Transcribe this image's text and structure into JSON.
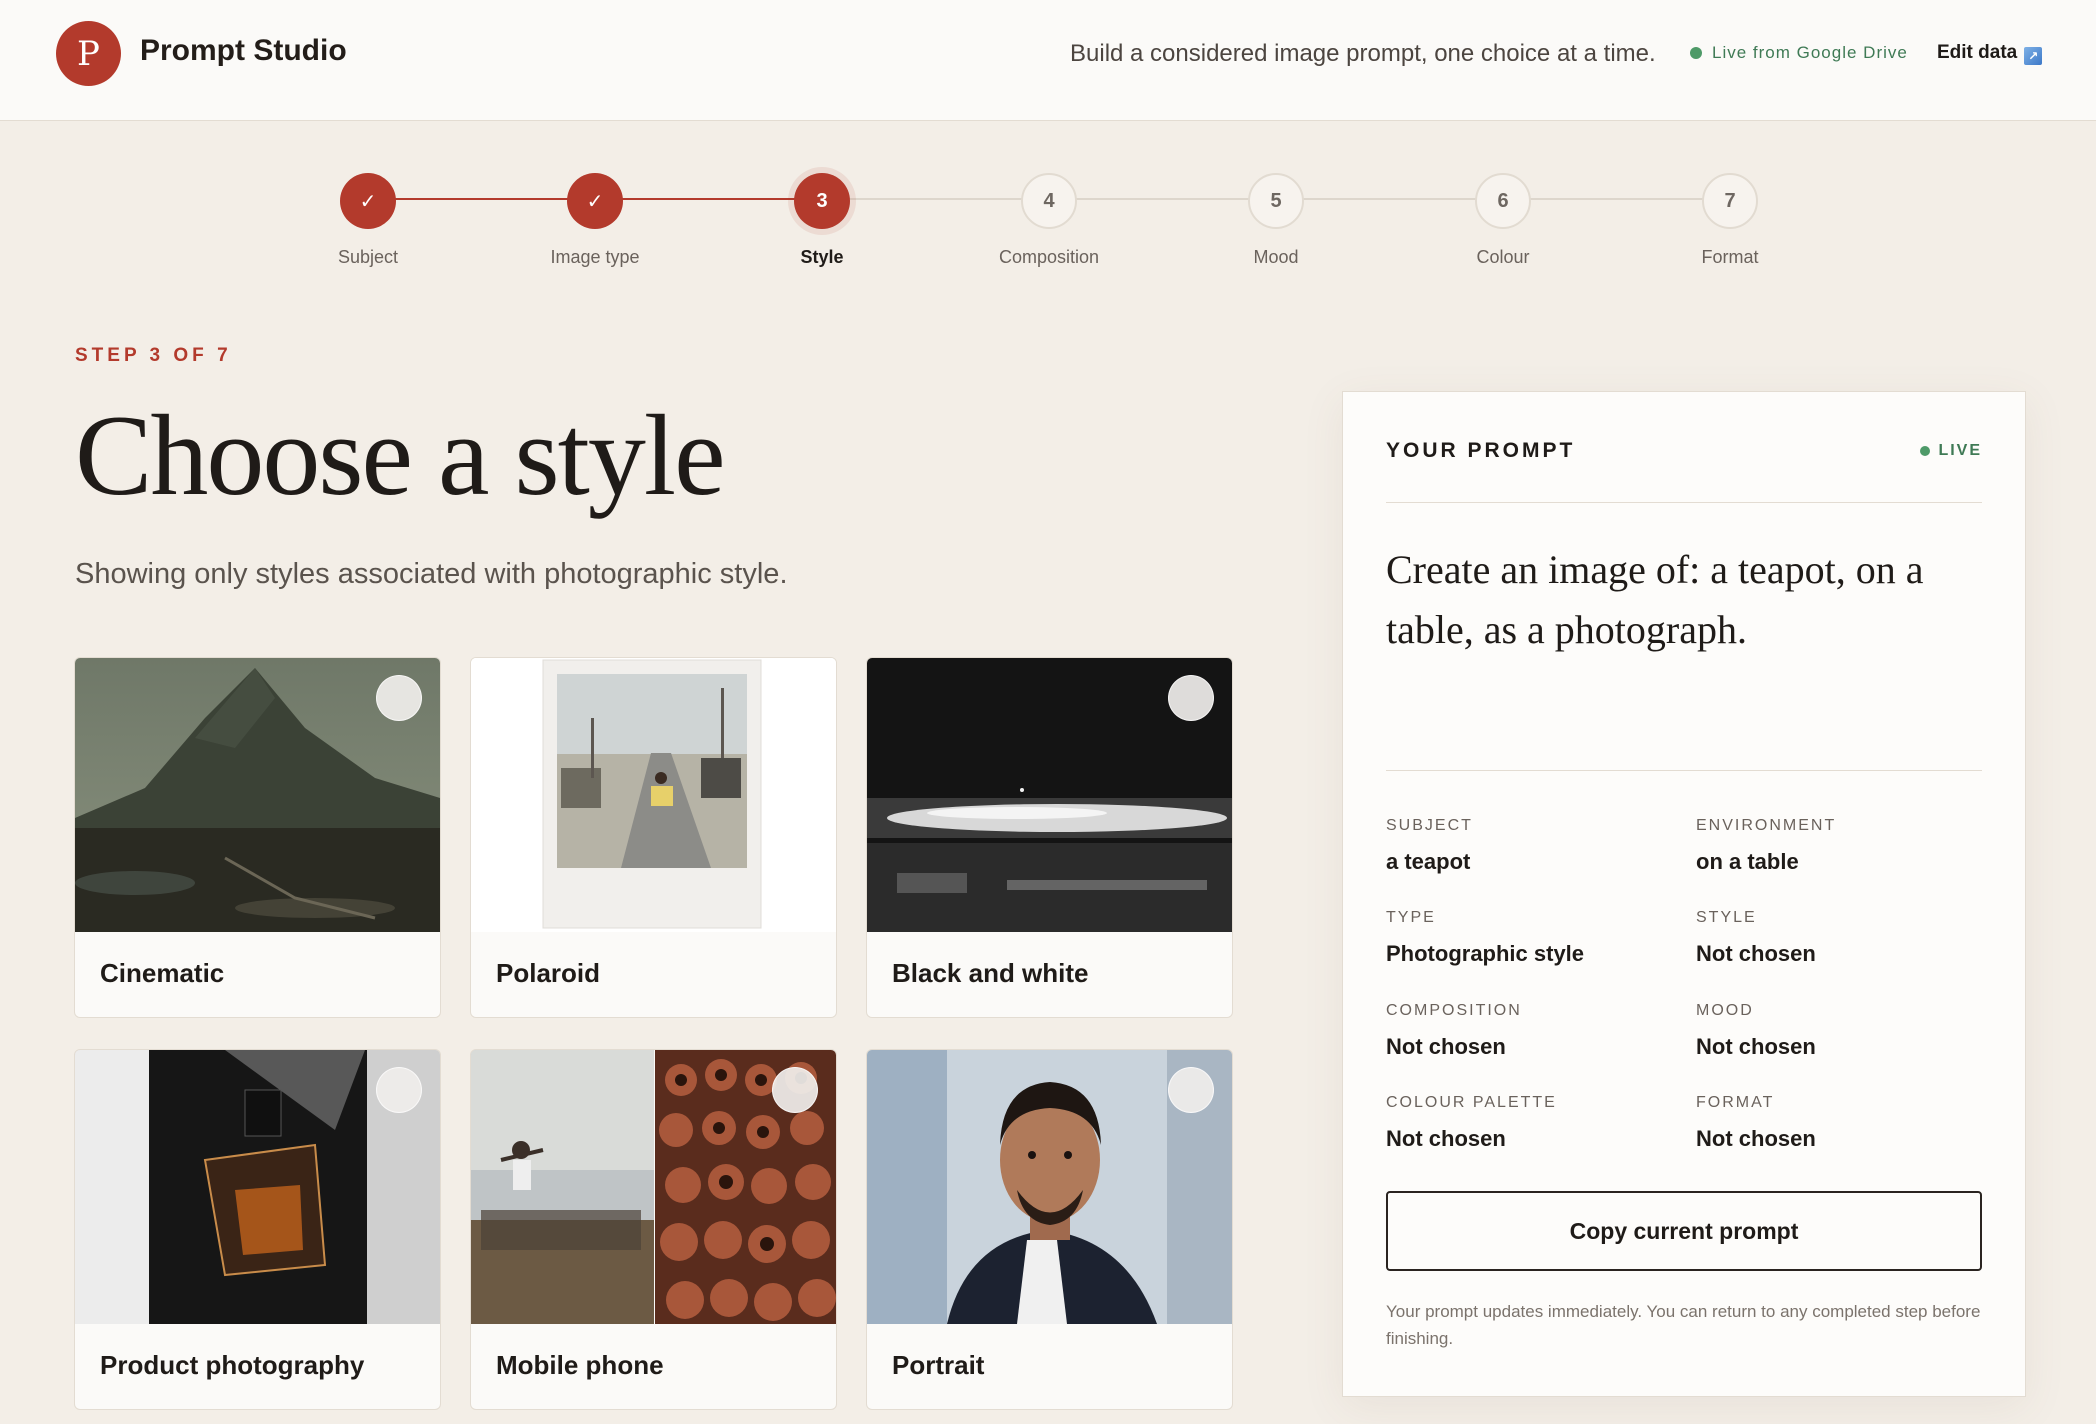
{
  "header": {
    "logo_letter": "P",
    "app_title": "Prompt Studio",
    "tagline": "Build a considered image prompt, one choice at a time.",
    "live_source": "Live from Google Drive",
    "edit_data_label": "Edit data"
  },
  "stepper": {
    "steps": [
      {
        "number": "1",
        "label": "Subject",
        "status": "done",
        "mark": "✓"
      },
      {
        "number": "2",
        "label": "Image type",
        "status": "done",
        "mark": "✓"
      },
      {
        "number": "3",
        "label": "Style",
        "status": "current",
        "mark": "3"
      },
      {
        "number": "4",
        "label": "Composition",
        "status": "upcoming",
        "mark": "4"
      },
      {
        "number": "5",
        "label": "Mood",
        "status": "upcoming",
        "mark": "5"
      },
      {
        "number": "6",
        "label": "Colour",
        "status": "upcoming",
        "mark": "6"
      },
      {
        "number": "7",
        "label": "Format",
        "status": "upcoming",
        "mark": "7"
      }
    ]
  },
  "main": {
    "eyebrow": "STEP 3 OF 7",
    "title": "Choose a style",
    "subtitle": "Showing only styles associated with photographic style.",
    "styles": [
      {
        "label": "Cinematic",
        "image": "misty-mountain-photo"
      },
      {
        "label": "Polaroid",
        "image": "polaroid-street-photo"
      },
      {
        "label": "Black and white",
        "image": "monochrome-landscape-photo"
      },
      {
        "label": "Product photography",
        "image": "perfume-bottle-photo"
      },
      {
        "label": "Mobile phone",
        "image": "phone-snapshots-photo"
      },
      {
        "label": "Portrait",
        "image": "man-portrait-photo"
      }
    ]
  },
  "panel": {
    "heading": "YOUR PROMPT",
    "live_label": "LIVE",
    "prompt": "Create an image of: a teapot, on a table, as a photograph.",
    "fields": [
      {
        "key": "SUBJECT",
        "value": "a teapot"
      },
      {
        "key": "ENVIRONMENT",
        "value": "on a table"
      },
      {
        "key": "TYPE",
        "value": "Photographic style"
      },
      {
        "key": "STYLE",
        "value": "Not chosen"
      },
      {
        "key": "COMPOSITION",
        "value": "Not chosen"
      },
      {
        "key": "MOOD",
        "value": "Not chosen"
      },
      {
        "key": "COLOUR PALETTE",
        "value": "Not chosen"
      },
      {
        "key": "FORMAT",
        "value": "Not chosen"
      }
    ],
    "copy_button": "Copy current prompt",
    "note": "Your prompt updates immediately. You can return to any completed step before finishing."
  },
  "colors": {
    "accent": "#b33a2c",
    "live_green": "#4e9a68",
    "background": "#f3eee7"
  }
}
